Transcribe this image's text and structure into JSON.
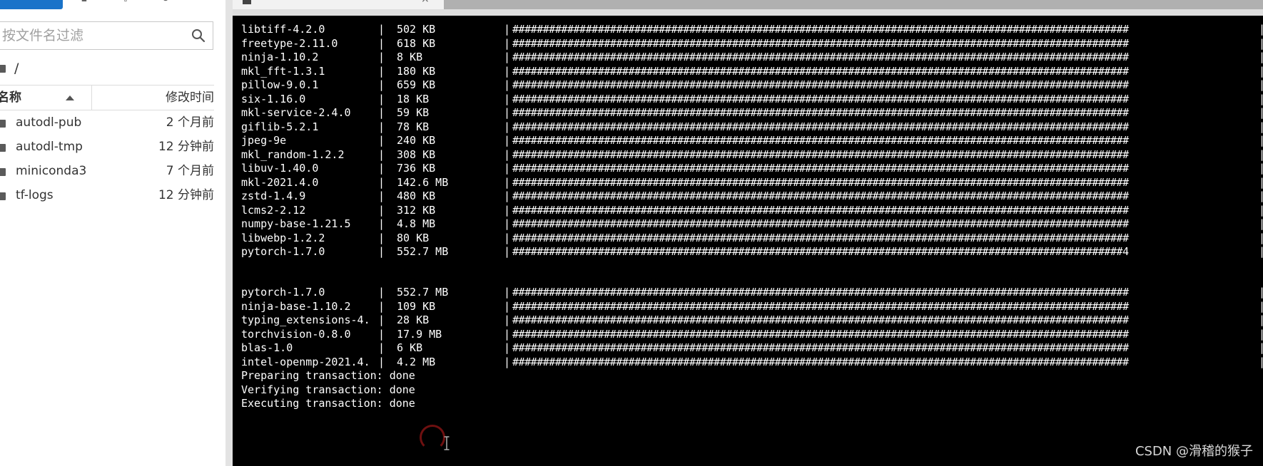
{
  "sidebar": {
    "filter": {
      "placeholder": "按文件名过滤",
      "value": ""
    },
    "breadcrumb": "/",
    "columns": {
      "name": "名称",
      "modified": "修改时间"
    },
    "files": [
      {
        "name": "autodl-pub",
        "modified": "2 个月前"
      },
      {
        "name": "autodl-tmp",
        "modified": "12 分钟前"
      },
      {
        "name": "miniconda3",
        "modified": "7 个月前"
      },
      {
        "name": "tf-logs",
        "modified": "12 分钟前"
      }
    ]
  },
  "terminal": {
    "packages_first": [
      {
        "name": "libtiff-4.2.0",
        "size": "502 KB",
        "bar": "#####################################################################################################",
        "pct": "100%"
      },
      {
        "name": "freetype-2.11.0",
        "size": "618 KB",
        "bar": "#####################################################################################################",
        "pct": "100%"
      },
      {
        "name": "ninja-1.10.2",
        "size": "8 KB",
        "bar": "#####################################################################################################",
        "pct": "100%"
      },
      {
        "name": "mkl_fft-1.3.1",
        "size": "180 KB",
        "bar": "#####################################################################################################",
        "pct": "100%"
      },
      {
        "name": "pillow-9.0.1",
        "size": "659 KB",
        "bar": "#####################################################################################################",
        "pct": "100%"
      },
      {
        "name": "six-1.16.0",
        "size": "18 KB",
        "bar": "#####################################################################################################",
        "pct": "100%"
      },
      {
        "name": "mkl-service-2.4.0",
        "size": "59 KB",
        "bar": "#####################################################################################################",
        "pct": "100%"
      },
      {
        "name": "giflib-5.2.1",
        "size": "78 KB",
        "bar": "#####################################################################################################",
        "pct": "100%"
      },
      {
        "name": "jpeg-9e",
        "size": "240 KB",
        "bar": "#####################################################################################################",
        "pct": "100%"
      },
      {
        "name": "mkl_random-1.2.2",
        "size": "308 KB",
        "bar": "#####################################################################################################",
        "pct": "100%"
      },
      {
        "name": "libuv-1.40.0",
        "size": "736 KB",
        "bar": "#####################################################################################################",
        "pct": "100%"
      },
      {
        "name": "mkl-2021.4.0",
        "size": "142.6 MB",
        "bar": "#####################################################################################################",
        "pct": "100%"
      },
      {
        "name": "zstd-1.4.9",
        "size": "480 KB",
        "bar": "#####################################################################################################",
        "pct": "100%"
      },
      {
        "name": "lcms2-2.12",
        "size": "312 KB",
        "bar": "#####################################################################################################",
        "pct": "100%"
      },
      {
        "name": "numpy-base-1.21.5",
        "size": "4.8 MB",
        "bar": "#####################################################################################################",
        "pct": "100%"
      },
      {
        "name": "libwebp-1.2.2",
        "size": "80 KB",
        "bar": "#####################################################################################################",
        "pct": "100%"
      },
      {
        "name": "pytorch-1.7.0",
        "size": "552.7 MB",
        "bar": "####################################################################################################4",
        "pct": "100%"
      }
    ],
    "packages_second": [
      {
        "name": "pytorch-1.7.0",
        "size": "552.7 MB",
        "bar": "#####################################################################################################",
        "pct": "100%"
      },
      {
        "name": "ninja-base-1.10.2",
        "size": "109 KB",
        "bar": "#####################################################################################################",
        "pct": "100%"
      },
      {
        "name": "typing_extensions-4.",
        "size": "28 KB",
        "bar": "#####################################################################################################",
        "pct": "100%"
      },
      {
        "name": "torchvision-0.8.0",
        "size": "17.9 MB",
        "bar": "#####################################################################################################",
        "pct": "100%"
      },
      {
        "name": "blas-1.0",
        "size": "6 KB",
        "bar": "#####################################################################################################",
        "pct": "100%"
      },
      {
        "name": "intel-openmp-2021.4.",
        "size": "4.2 MB",
        "bar": "#####################################################################################################",
        "pct": "100%"
      }
    ],
    "messages": [
      "Preparing transaction: done",
      "Verifying transaction: done",
      "Executing transaction: done"
    ]
  },
  "watermark": "CSDN @滑稽的猴子"
}
